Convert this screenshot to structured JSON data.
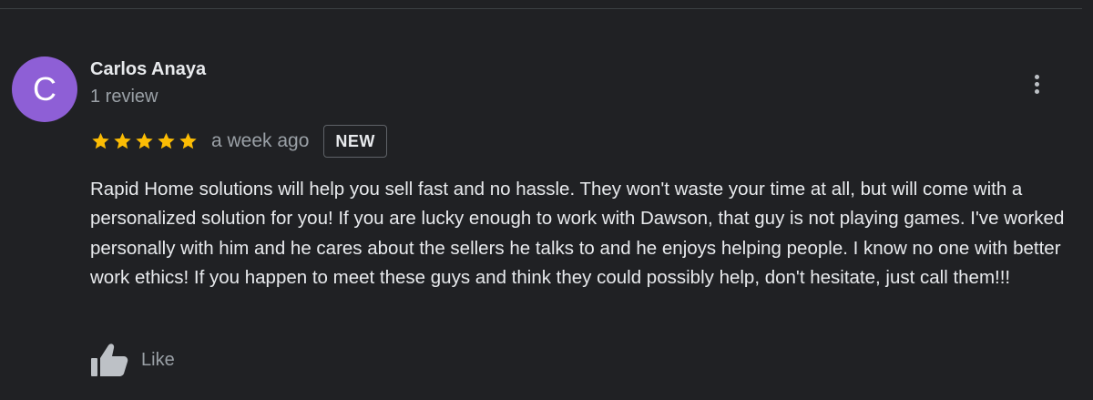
{
  "review": {
    "avatar_letter": "C",
    "author_name": "Carlos Anaya",
    "review_count": "1 review",
    "rating": 5,
    "max_rating": 5,
    "date": "a week ago",
    "badge": "NEW",
    "text": "Rapid Home solutions will help you sell fast and no hassle. They won't waste your time at all, but will come with a personalized solution for you! If you are lucky enough to work with Dawson, that guy is not playing games. I've worked personally with him and he cares about the sellers he talks to and he enjoys helping people. I know no one with better work ethics! If you happen to meet these guys and think they could possibly help, don't hesitate, just call them!!!",
    "like_label": "Like"
  },
  "icons": {
    "avatar": "avatar-letter",
    "more": "more-vert-icon",
    "star": "star-icon",
    "like": "thumbs-up-icon"
  },
  "colors": {
    "background": "#202124",
    "avatar": "#8e5fd6",
    "star": "#fbbc04",
    "primary_text": "#e8eaed",
    "secondary_text": "#9aa0a6"
  }
}
